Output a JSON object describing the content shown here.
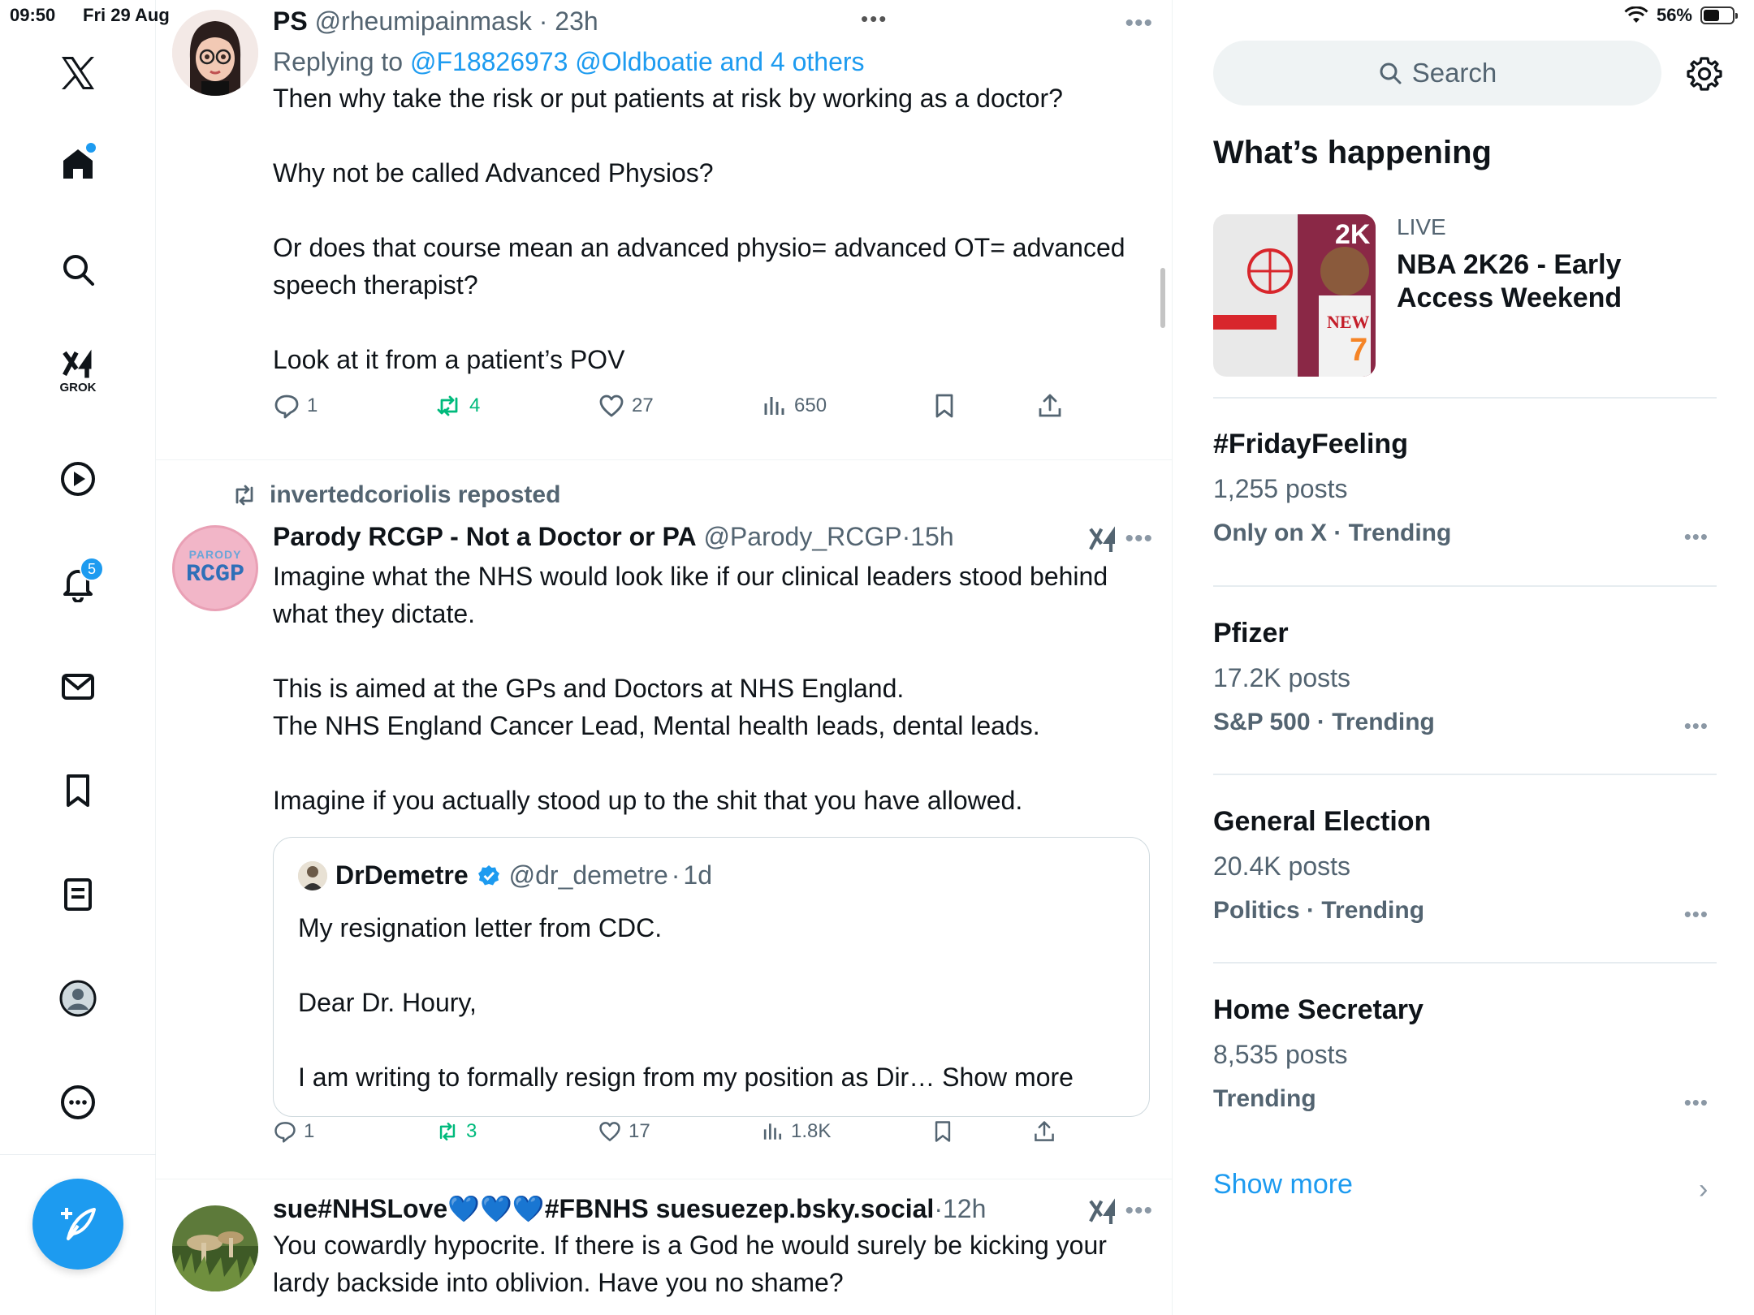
{
  "status_bar": {
    "time": "09:50",
    "date": "Fri 29 Aug",
    "battery": "56%",
    "battery_level": 0.56
  },
  "nav": {
    "grok_label": "GROK",
    "notifications_count": "5",
    "items": [
      "x-logo",
      "home-icon",
      "search-icon",
      "grok-icon",
      "video-icon",
      "notifications-icon",
      "messages-icon",
      "bookmarks-icon",
      "lists-icon",
      "profile-icon",
      "more-icon"
    ]
  },
  "tweets": [
    {
      "name": "PS",
      "handle": "@rheumipainmask",
      "sep": "·",
      "time": "23h",
      "replying_prefix": "Replying to ",
      "replying_links": "@F18826973 @Oldboatie and 4 others",
      "text": "Then why take the risk or put patients at risk by working as a doctor?\n\nWhy not be called Advanced Physios?\n\nOr does that course mean an advanced physio= advanced OT= advanced speech therapist?\n\nLook at it from a patient’s POV",
      "replies": "1",
      "reposts": "4",
      "likes": "27",
      "views": "650"
    },
    {
      "repost_by": "invertedcoriolis reposted",
      "name": "Parody RCGP - Not a Doctor or PA",
      "handle": "@Parody_RCGP",
      "sep": "·",
      "time": "15h",
      "avatar_top": "PARODY",
      "avatar_main": "RCGP",
      "text": "Imagine what the NHS would look like if our clinical leaders stood behind what they dictate.\n\nThis is aimed at the GPs and Doctors at NHS England.\nThe NHS England Cancer Lead, Mental health leads, dental leads.\n\nImagine if you actually stood up to the shit that you have allowed.",
      "quote": {
        "name": "DrDemetre",
        "handle": "@dr_demetre",
        "sep": "·",
        "time": "1d",
        "text": "My resignation letter from CDC.\n\nDear Dr. Houry,\n\nI am writing to formally resign from my position as Dir… Show more"
      },
      "replies": "1",
      "reposts": "3",
      "likes": "17",
      "views": "1.8K"
    },
    {
      "name": "sue#NHSLove💙💙💙#FBNHS suesuezep.bsky.social",
      "sep": "·",
      "time": "12h",
      "text": "You cowardly hypocrite. If there is a God he would surely be kicking your lardy backside into oblivion. Have you no shame?"
    }
  ],
  "sidebar": {
    "search_placeholder": "Search",
    "title": "What’s happening",
    "promo": {
      "label": "LIVE",
      "title": "NBA 2K26 - Early Access Weekend"
    },
    "trends": [
      {
        "title": "#FridayFeeling",
        "count": "1,255 posts",
        "meta": "Only on X · Trending"
      },
      {
        "title": "Pfizer",
        "count": "17.2K posts",
        "meta": "S&P 500 · Trending"
      },
      {
        "title": "General Election",
        "count": "20.4K posts",
        "meta": "Politics · Trending"
      },
      {
        "title": "Home Secretary",
        "count": "8,535 posts",
        "meta": "Trending"
      }
    ],
    "show_more": "Show more"
  },
  "colors": {
    "accent": "#1d9bf0",
    "repost": "#00ba7c",
    "muted": "#536471"
  }
}
